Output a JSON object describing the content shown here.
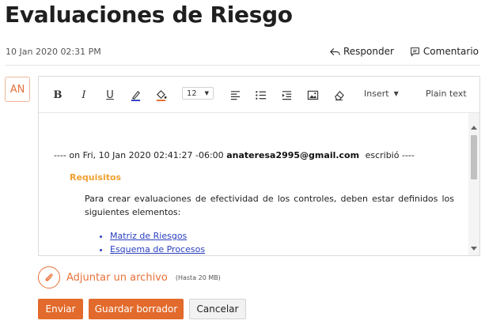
{
  "header": {
    "title": "Evaluaciones de Riesgo",
    "date": "10 Jan 2020 02:31 PM",
    "reply_label": "Responder",
    "comment_label": "Comentario"
  },
  "avatar": {
    "initials": "AN"
  },
  "toolbar": {
    "bold": "B",
    "italic": "I",
    "underline": "U",
    "font_size": "12",
    "insert_label": "Insert",
    "plain_text_label": "Plain text",
    "icons": [
      "bold-icon",
      "italic-icon",
      "underline-icon",
      "text-color-icon",
      "fill-color-icon",
      "align-left-icon",
      "bullet-list-icon",
      "indent-icon",
      "image-icon",
      "eraser-icon"
    ]
  },
  "content": {
    "quote_prefix": "---- on Fri, 10 Jan 2020 02:41:27 -06:00",
    "quote_email": "anateresa2995@gmail.com",
    "quote_suffix": "escribió ----",
    "requirements_heading": "Requisitos",
    "paragraph": "Para crear evaluaciones de efectividad de los controles, deben estar definidos los siguientes elementos:",
    "list_items": [
      "Matriz de Riesgos",
      "Esquema de Procesos"
    ]
  },
  "attach": {
    "label": "Adjuntar un archivo",
    "hint": "(Hasta 20 MB)"
  },
  "buttons": {
    "send": "Enviar",
    "save_draft": "Guardar borrador",
    "cancel": "Cancelar"
  },
  "colors": {
    "accent": "#e26a2c",
    "heading_orange": "#f0a030",
    "link_blue": "#2a3fbf"
  }
}
